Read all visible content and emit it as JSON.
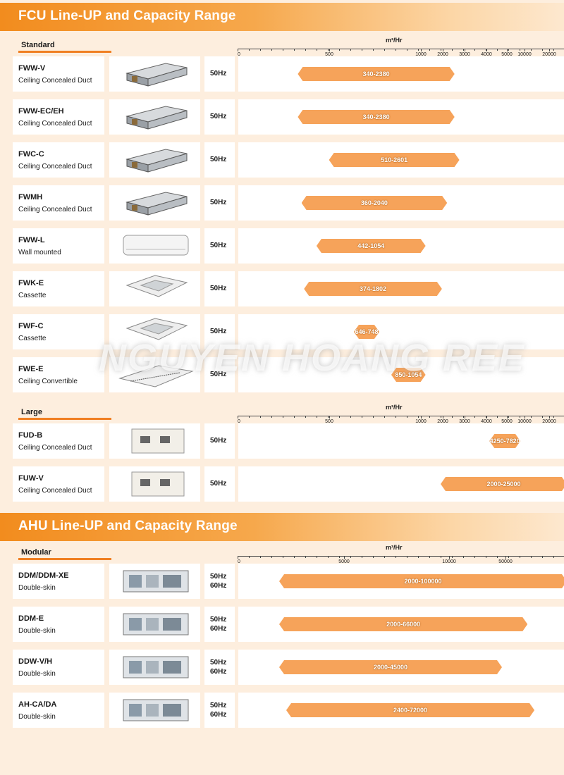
{
  "fcu": {
    "title": "FCU Line-UP and Capacity Range",
    "standard": {
      "label": "Standard",
      "unit": "m³/Hr",
      "ticks": [
        "0",
        "500",
        "1000",
        "2000",
        "3000",
        "4000",
        "5000",
        "10000",
        "20000"
      ],
      "rows": [
        {
          "model": "FWW-V",
          "type": "Ceiling Concealed Duct",
          "hz": [
            "50Hz"
          ],
          "range": "340-2380",
          "from": 340,
          "to": 2380,
          "icon": "duct-unit"
        },
        {
          "model": "FWW-EC/EH",
          "type": "Ceiling Concealed Duct",
          "hz": [
            "50Hz"
          ],
          "range": "340-2380",
          "from": 340,
          "to": 2380,
          "icon": "duct-unit"
        },
        {
          "model": "FWC-C",
          "type": "Ceiling Concealed Duct",
          "hz": [
            "50Hz"
          ],
          "range": "510-2601",
          "from": 510,
          "to": 2601,
          "icon": "duct-unit"
        },
        {
          "model": "FWMH",
          "type": "Ceiling Concealed Duct",
          "hz": [
            "50Hz"
          ],
          "range": "360-2040",
          "from": 360,
          "to": 2040,
          "icon": "duct-unit"
        },
        {
          "model": "FWW-L",
          "type": "Wall mounted",
          "hz": [
            "50Hz"
          ],
          "range": "442-1054",
          "from": 442,
          "to": 1054,
          "icon": "wall-unit"
        },
        {
          "model": "FWK-E",
          "type": "Cassette",
          "hz": [
            "50Hz"
          ],
          "range": "374-1802",
          "from": 374,
          "to": 1802,
          "icon": "cassette-unit"
        },
        {
          "model": "FWF-C",
          "type": "Cassette",
          "hz": [
            "50Hz"
          ],
          "range": "646-748",
          "from": 646,
          "to": 748,
          "icon": "cassette-unit"
        },
        {
          "model": "FWE-E",
          "type": "Ceiling Convertible",
          "hz": [
            "50Hz"
          ],
          "range": "850-1054",
          "from": 850,
          "to": 1054,
          "icon": "convertible-unit"
        }
      ]
    },
    "large": {
      "label": "Large",
      "unit": "m³/Hr",
      "ticks": [
        "0",
        "500",
        "1000",
        "2000",
        "3000",
        "4000",
        "5000",
        "10000",
        "20000"
      ],
      "rows": [
        {
          "model": "FUD-B",
          "type": "Ceiling Concealed Duct",
          "hz": [
            "50Hz"
          ],
          "range": "4250-7820",
          "from": 4250,
          "to": 7820,
          "icon": "large-duct-unit"
        },
        {
          "model": "FUW-V",
          "type": "Ceiling Concealed Duct",
          "hz": [
            "50Hz"
          ],
          "range": "2000-25000",
          "from": 2000,
          "to": 25000,
          "icon": "large-duct-unit"
        }
      ]
    }
  },
  "ahu": {
    "title": "AHU Line-UP and Capacity Range",
    "modular": {
      "label": "Modular",
      "unit": "m³/Hr",
      "ticks": [
        "0",
        "5000",
        "10000",
        "50000"
      ],
      "rows": [
        {
          "model": "DDM/DDM-XE",
          "type": "Double-skin",
          "hz": [
            "50Hz",
            "60Hz"
          ],
          "range": "2000-100000",
          "from": 2000,
          "to": 100000,
          "icon": "ahu-unit"
        },
        {
          "model": "DDM-E",
          "type": "Double-skin",
          "hz": [
            "50Hz",
            "60Hz"
          ],
          "range": "2000-66000",
          "from": 2000,
          "to": 66000,
          "icon": "ahu-unit"
        },
        {
          "model": "DDW-V/H",
          "type": "Double-skin",
          "hz": [
            "50Hz",
            "60Hz"
          ],
          "range": "2000-45000",
          "from": 2000,
          "to": 45000,
          "icon": "ahu-unit"
        },
        {
          "model": "AH-CA/DA",
          "type": "Double-skin",
          "hz": [
            "50Hz",
            "60Hz"
          ],
          "range": "2400-72000",
          "from": 2400,
          "to": 72000,
          "icon": "ahu-unit"
        }
      ]
    }
  },
  "watermark": "NGUYEN HOANG REE"
}
